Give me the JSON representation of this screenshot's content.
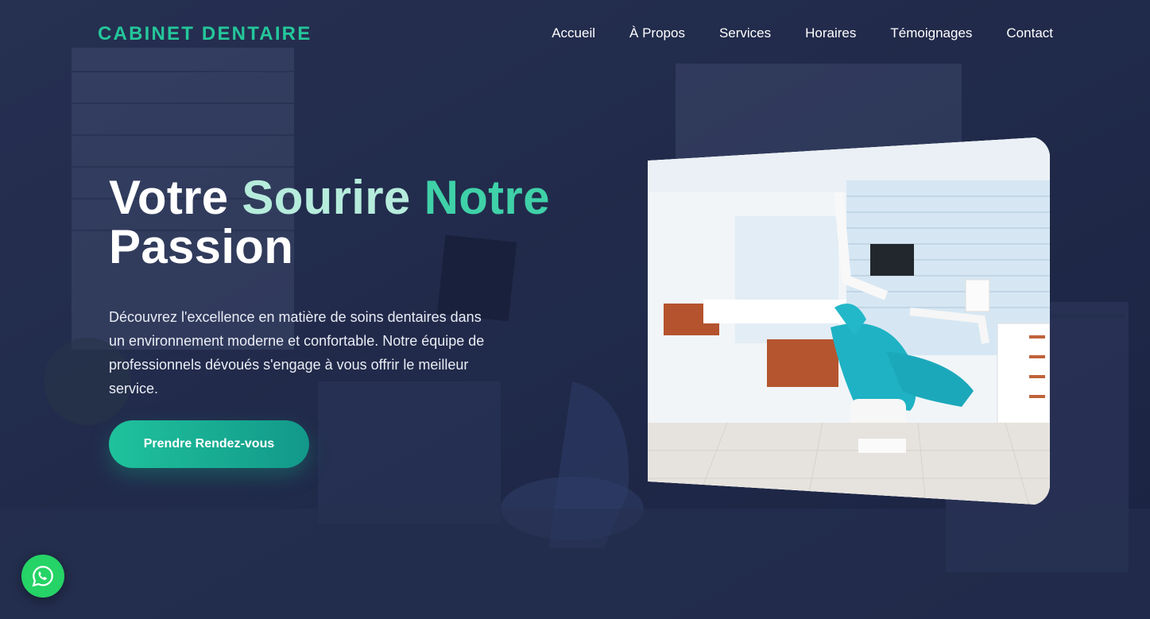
{
  "brand": {
    "name": "CABINET DENTAIRE",
    "color": "#24c79a"
  },
  "nav": {
    "items": [
      "Accueil",
      "À Propos",
      "Services",
      "Horaires",
      "Témoignages",
      "Contact"
    ]
  },
  "hero": {
    "title_word_1": "Votre",
    "title_word_2": "Sourire",
    "title_word_3": "Notre",
    "title_word_4": "Passion",
    "description": "Découvrez l'excellence en matière de soins dentaires dans un environnement moderne et confortable. Notre équipe de professionnels dévoués s'engage à vous offrir le meilleur service.",
    "cta_label": "Prendre Rendez-vous"
  },
  "floating_button": {
    "icon": "whatsapp-icon"
  },
  "colors": {
    "accent": "#24c79a",
    "background": "#1e2748",
    "whatsapp": "#25d366"
  }
}
